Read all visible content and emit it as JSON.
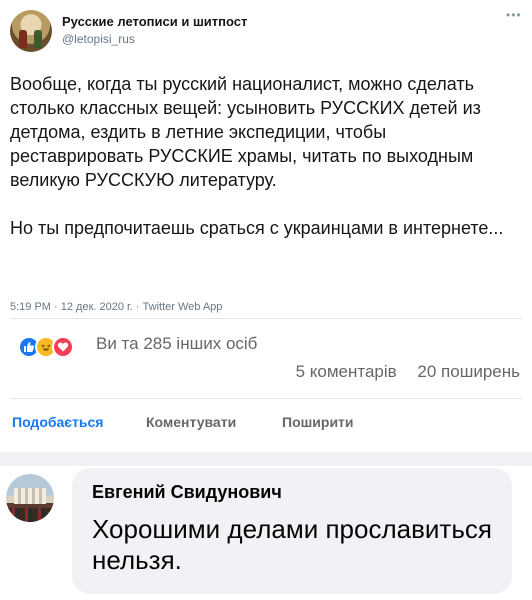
{
  "tweet": {
    "account_name": "Русские летописи и шитпост",
    "handle": "@letopisi_rus",
    "more_icon": "more-dots-icon",
    "paragraphs": [
      "Вообще, когда ты русский националист, можно сделать столько классных вещей: усыновить РУССКИХ детей из детдома, ездить в летние экспедиции, чтобы реставрировать РУССКИЕ храмы, читать по выходным великую РУССКУЮ литературу.",
      "Но ты предпочитаешь сраться с украинцами в интернете..."
    ],
    "meta": "5:19 PM · 12 дек. 2020 г. · Twitter Web App"
  },
  "post": {
    "reaction_icons": [
      "like-icon",
      "haha-icon",
      "love-icon"
    ],
    "reactions_text": "Ви та 285 інших осіб",
    "comments_count": "5 коментарів",
    "shares_count": "20 поширень",
    "actions": {
      "like": "Подобається",
      "comment": "Коментувати",
      "share": "Поширити"
    }
  },
  "comment": {
    "author": "Евгений Свидунович",
    "text": "Хорошими делами прославиться нельзя."
  },
  "colors": {
    "accent": "#1877f2",
    "like": "#1877f2",
    "haha": "#f7b928",
    "love": "#f33e58"
  }
}
